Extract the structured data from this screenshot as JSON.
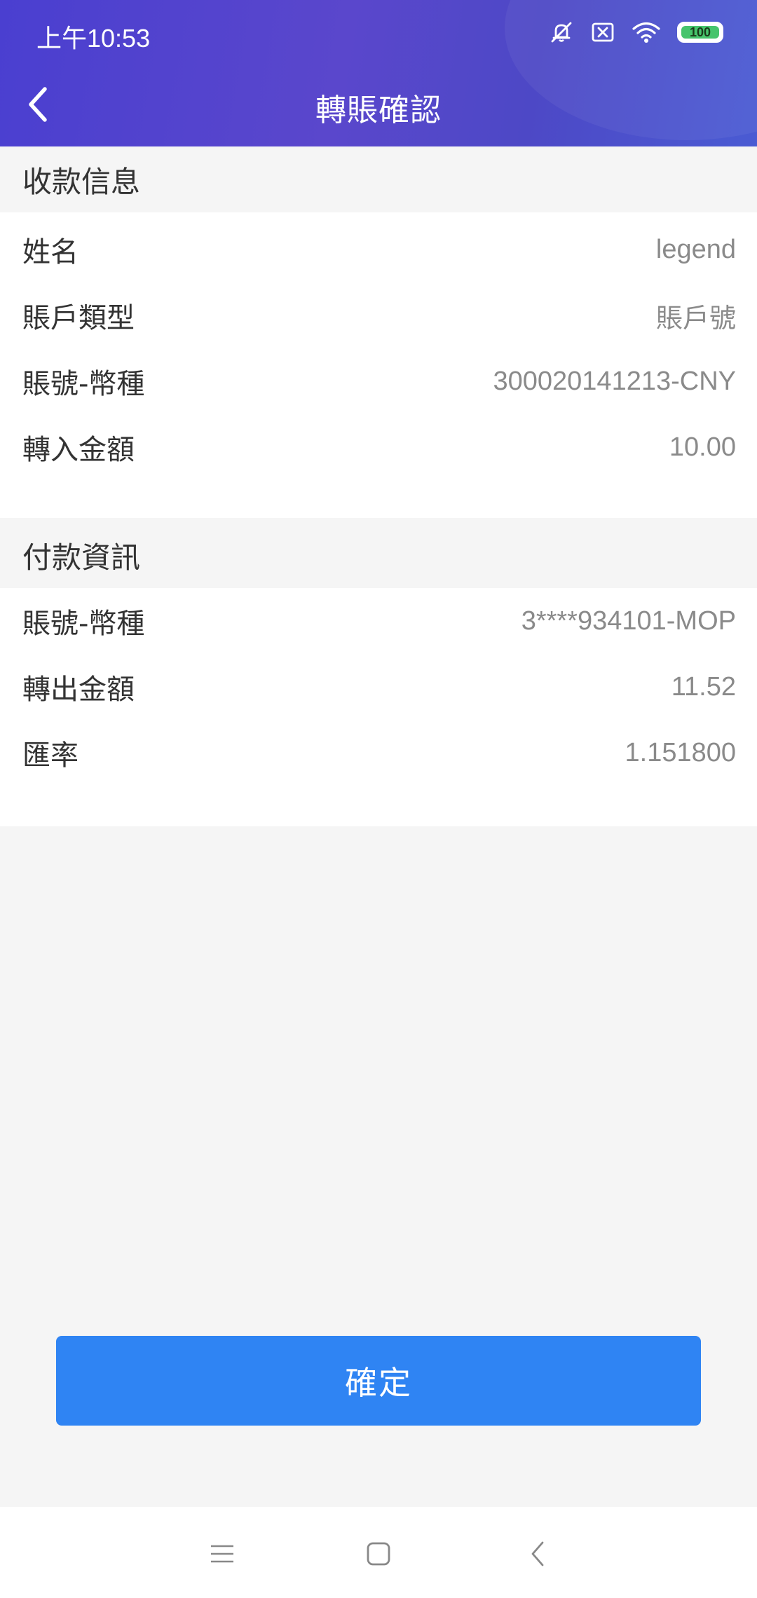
{
  "status_bar": {
    "time": "上午10:53",
    "icons": [
      "mute-icon",
      "sim-off-icon",
      "wifi-icon",
      "battery-icon"
    ],
    "battery_level": "100",
    "battery_color": "#46c46c"
  },
  "header": {
    "title": "轉賬確認",
    "gradient_start": "#4a3fd0",
    "gradient_end": "#4a5bd3"
  },
  "payee_section": {
    "heading": "收款信息",
    "rows": [
      {
        "label": "姓名",
        "value": "legend"
      },
      {
        "label": "賬戶類型",
        "value": "賬戶號"
      },
      {
        "label": "賬號-幣種",
        "value": "300020141213-CNY"
      },
      {
        "label": "轉入金額",
        "value": "10.00"
      }
    ]
  },
  "payer_section": {
    "heading": "付款資訊",
    "rows": [
      {
        "label": "賬號-幣種",
        "value": "3****934101-MOP"
      },
      {
        "label": "轉出金額",
        "value": "11.52"
      },
      {
        "label": "匯率",
        "value": "1.151800"
      }
    ]
  },
  "confirm_button": {
    "label": "確定",
    "color": "#2f84f3"
  },
  "nav_bar": {
    "icons": [
      "menu-icon",
      "home-icon",
      "back-icon"
    ]
  }
}
